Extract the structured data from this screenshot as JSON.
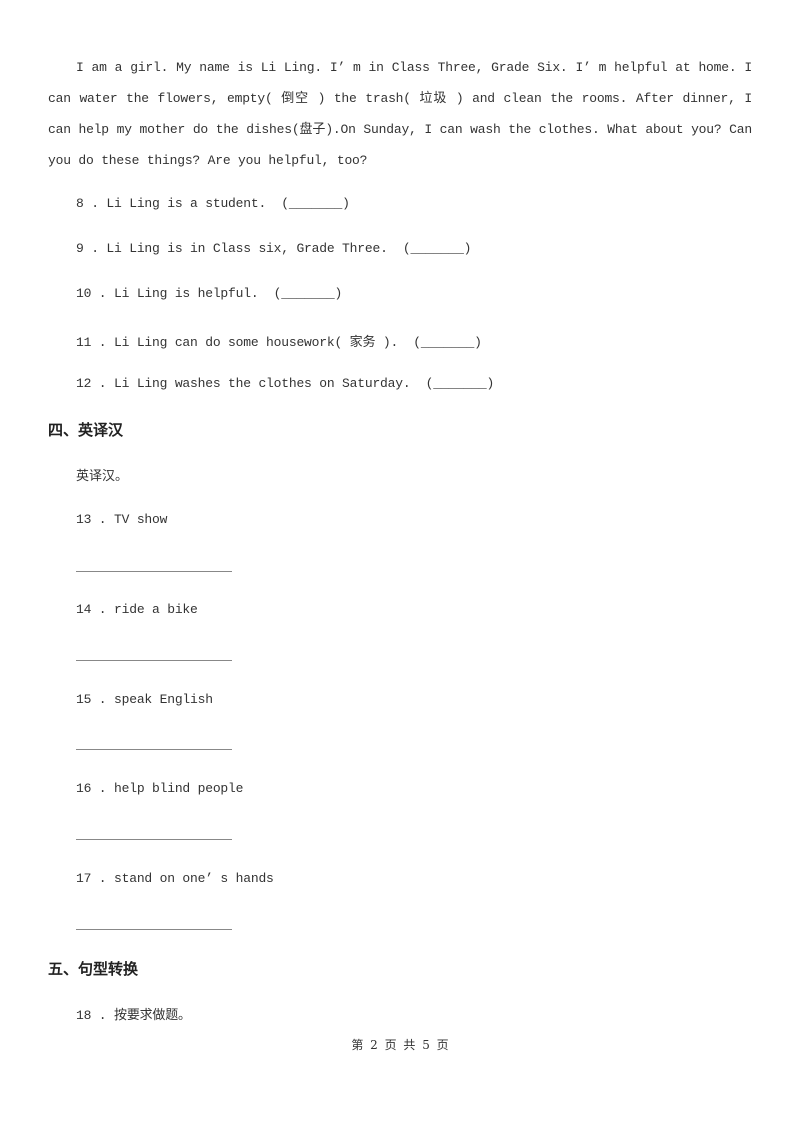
{
  "passage": "I am a girl. My name is Li Ling. I’ m in Class Three, Grade Six. I’ m helpful at home. I can water the flowers, empty( 倒空  ) the trash( 垃圾 ) and  clean the rooms. After dinner, I can help my mother do the dishes(盘子).On Sunday,  I can wash the clothes. What about you? Can you do these things? Are you helpful, too?",
  "true_false": [
    {
      "num": "8",
      "text": "Li Ling is a student.",
      "blank": "(_______)"
    },
    {
      "num": "9",
      "text": "Li Ling is in Class six, Grade Three.",
      "blank": "(_______)"
    },
    {
      "num": "10",
      "text": "Li Ling is helpful.",
      "blank": "(_______)"
    },
    {
      "num": "11",
      "text": "Li Ling can do some housework( 家务 ).",
      "blank": "(_______)"
    },
    {
      "num": "12",
      "text": "Li Ling washes the clothes on Saturday.",
      "blank": "(_______)"
    }
  ],
  "section4": {
    "heading": "四、英译汉",
    "instruction": "英译汉。",
    "items": [
      {
        "num": "13",
        "text": "TV show"
      },
      {
        "num": "14",
        "text": "ride a bike"
      },
      {
        "num": "15",
        "text": "speak English"
      },
      {
        "num": "16",
        "text": "help blind people"
      },
      {
        "num": "17",
        "text": "stand on one’ s hands"
      }
    ]
  },
  "section5": {
    "heading": "五、句型转换",
    "items": [
      {
        "num": "18",
        "text": "按要求做题。"
      }
    ]
  },
  "footer": "第 2 页 共 5 页"
}
